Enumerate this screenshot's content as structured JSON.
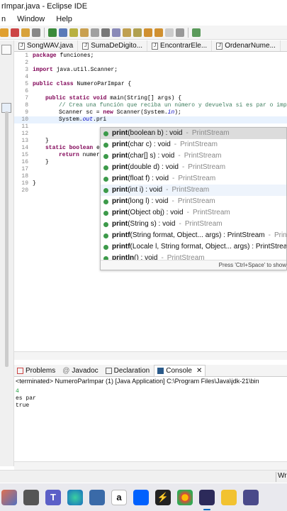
{
  "window": {
    "title": "rImpar.java - Eclipse IDE"
  },
  "menu": {
    "items": [
      "n",
      "Window",
      "Help"
    ]
  },
  "editor_tabs": [
    "SongWAV.java",
    "SumaDeDigito...",
    "EncontrarEle...",
    "OrdenarNume..."
  ],
  "code": {
    "line_numbers": [
      "1",
      "2",
      "3",
      "4",
      "5",
      "6",
      "7",
      "8",
      "9",
      "10",
      "11",
      "12",
      "13",
      "14",
      "15",
      "16",
      "17",
      "18",
      "19",
      "20"
    ],
    "l1_kw": "package",
    "l1_rest": " funciones;",
    "l3_kw": "import",
    "l3_rest": " java.util.Scanner;",
    "l5_kw": "public class",
    "l5_rest": " NumeroParImpar {",
    "l7_kw": "public static void",
    "l7_rest": " main(String[] args) {",
    "l8": "// Crea una función que reciba un número y devuelva si es par o impar",
    "l9_a": "Scanner sc = ",
    "l9_kw": "new",
    "l9_b": " Scanner(System.",
    "l9_fld": "in",
    "l9_c": ");",
    "l10_a": "System.",
    "l10_fld": "out",
    "l10_b": ".pri",
    "l13": "}",
    "l14_kw": "static boolean",
    "l14_rest": " e",
    "l15_kw": "return",
    "l15_rest": " numer",
    "l16": "}",
    "l19": "}"
  },
  "autocomplete": {
    "items": [
      {
        "prefix": "print",
        "rest": "(boolean b) : void",
        "type": "PrintStream"
      },
      {
        "prefix": "print",
        "rest": "(char c) : void",
        "type": "PrintStream"
      },
      {
        "prefix": "print",
        "rest": "(char[] s) : void",
        "type": "PrintStream"
      },
      {
        "prefix": "print",
        "rest": "(double d) : void",
        "type": "PrintStream"
      },
      {
        "prefix": "print",
        "rest": "(float f) : void",
        "type": "PrintStream"
      },
      {
        "prefix": "print",
        "rest": "(int i) : void",
        "type": "PrintStream"
      },
      {
        "prefix": "print",
        "rest": "(long l) : void",
        "type": "PrintStream"
      },
      {
        "prefix": "print",
        "rest": "(Object obj) : void",
        "type": "PrintStream"
      },
      {
        "prefix": "print",
        "rest": "(String s) : void",
        "type": "PrintStream"
      },
      {
        "prefix": "printf",
        "rest": "(String format, Object... args) : PrintStream",
        "type": "PrintSt"
      },
      {
        "prefix": "printf",
        "rest": "(Locale l, String format, Object... args) : PrintStream",
        "type": ""
      },
      {
        "prefix": "println",
        "rest": "() : void",
        "type": "PrintStream"
      }
    ],
    "footer": "Press 'Ctrl+Space' to show"
  },
  "console_tabs": [
    "Problems",
    "Javadoc",
    "Declaration",
    "Console"
  ],
  "console": {
    "status": "<terminated> NumeroParImpar (1) [Java Application] C:\\Program Files\\Java\\jdk-21\\bin",
    "input": "4",
    "lines": [
      "es par",
      "true"
    ]
  },
  "statusbar": {
    "mode": "Wri"
  },
  "colors": {
    "keyword": "#7f0055",
    "comment": "#3f7f5f",
    "field": "#0000c0",
    "selection": "#dcdcdc",
    "accent": "#0067c0"
  }
}
